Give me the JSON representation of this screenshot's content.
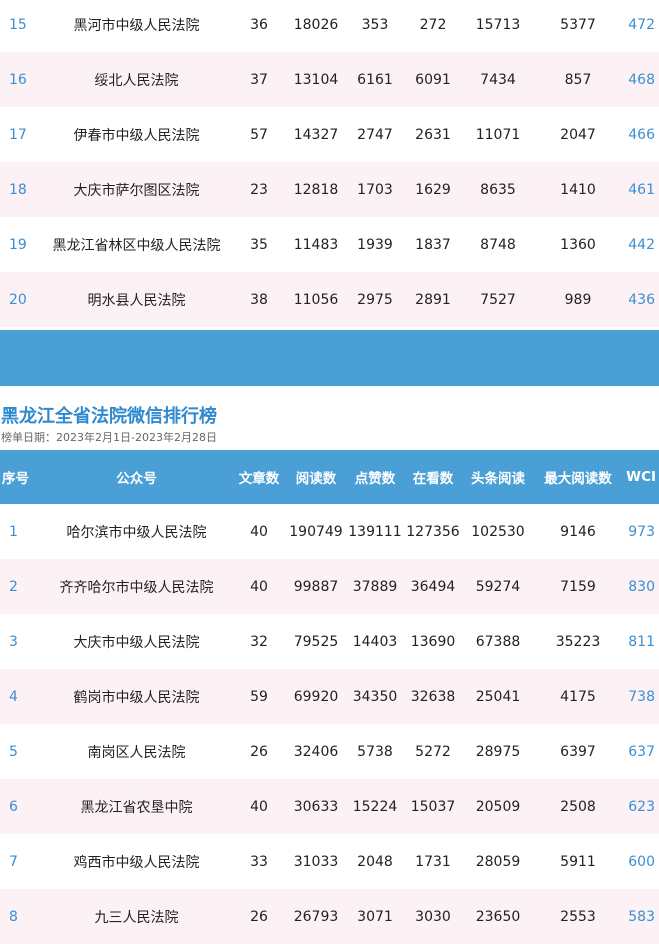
{
  "top_rows": [
    {
      "rank": "15",
      "name": "黑河市中级人民法院",
      "articles": "36",
      "reads": "18026",
      "likes": "353",
      "watching": "272",
      "headline": "15713",
      "max_read": "5377",
      "wci": "472"
    },
    {
      "rank": "16",
      "name": "绥北人民法院",
      "articles": "37",
      "reads": "13104",
      "likes": "6161",
      "watching": "6091",
      "headline": "7434",
      "max_read": "857",
      "wci": "468"
    },
    {
      "rank": "17",
      "name": "伊春市中级人民法院",
      "articles": "57",
      "reads": "14327",
      "likes": "2747",
      "watching": "2631",
      "headline": "11071",
      "max_read": "2047",
      "wci": "466"
    },
    {
      "rank": "18",
      "name": "大庆市萨尔图区法院",
      "articles": "23",
      "reads": "12818",
      "likes": "1703",
      "watching": "1629",
      "headline": "8635",
      "max_read": "1410",
      "wci": "461"
    },
    {
      "rank": "19",
      "name": "黑龙江省林区中级人民法院",
      "articles": "35",
      "reads": "11483",
      "likes": "1939",
      "watching": "1837",
      "headline": "8748",
      "max_read": "1360",
      "wci": "442"
    },
    {
      "rank": "20",
      "name": "明水县人民法院",
      "articles": "38",
      "reads": "11056",
      "likes": "2975",
      "watching": "2891",
      "headline": "7527",
      "max_read": "989",
      "wci": "436"
    }
  ],
  "section": {
    "title": "黑龙江全省法院微信排行榜",
    "subtitle": "榜单日期：2023年2月1日-2023年2月28日"
  },
  "headers": {
    "rank": "序号",
    "name": "公众号",
    "articles": "文章数",
    "reads": "阅读数",
    "likes": "点赞数",
    "watching": "在看数",
    "headline": "头条阅读",
    "max_read": "最大阅读数",
    "wci": "WCI"
  },
  "bottom_rows": [
    {
      "rank": "1",
      "name": "哈尔滨市中级人民法院",
      "articles": "40",
      "reads": "190749",
      "likes": "139111",
      "watching": "127356",
      "headline": "102530",
      "max_read": "9146",
      "wci": "973"
    },
    {
      "rank": "2",
      "name": "齐齐哈尔市中级人民法院",
      "articles": "40",
      "reads": "99887",
      "likes": "37889",
      "watching": "36494",
      "headline": "59274",
      "max_read": "7159",
      "wci": "830"
    },
    {
      "rank": "3",
      "name": "大庆市中级人民法院",
      "articles": "32",
      "reads": "79525",
      "likes": "14403",
      "watching": "13690",
      "headline": "67388",
      "max_read": "35223",
      "wci": "811"
    },
    {
      "rank": "4",
      "name": "鹤岗市中级人民法院",
      "articles": "59",
      "reads": "69920",
      "likes": "34350",
      "watching": "32638",
      "headline": "25041",
      "max_read": "4175",
      "wci": "738"
    },
    {
      "rank": "5",
      "name": "南岗区人民法院",
      "articles": "26",
      "reads": "32406",
      "likes": "5738",
      "watching": "5272",
      "headline": "28975",
      "max_read": "6397",
      "wci": "637"
    },
    {
      "rank": "6",
      "name": "黑龙江省农垦中院",
      "articles": "40",
      "reads": "30633",
      "likes": "15224",
      "watching": "15037",
      "headline": "20509",
      "max_read": "2508",
      "wci": "623"
    },
    {
      "rank": "7",
      "name": "鸡西市中级人民法院",
      "articles": "33",
      "reads": "31033",
      "likes": "2048",
      "watching": "1731",
      "headline": "28059",
      "max_read": "5911",
      "wci": "600"
    },
    {
      "rank": "8",
      "name": "九三人民法院",
      "articles": "26",
      "reads": "26793",
      "likes": "3071",
      "watching": "3030",
      "headline": "23650",
      "max_read": "2553",
      "wci": "583"
    }
  ]
}
